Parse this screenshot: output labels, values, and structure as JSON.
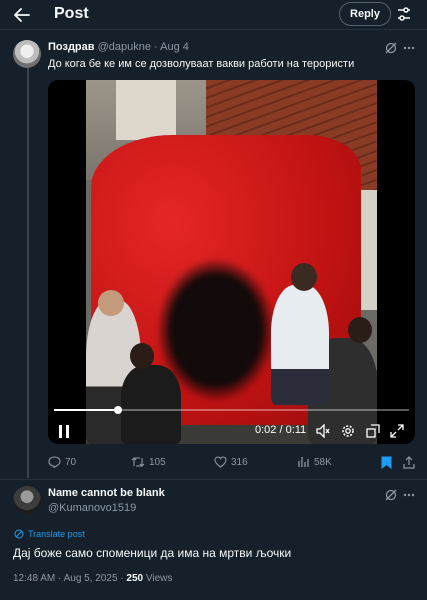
{
  "header": {
    "title": "Post",
    "reply_label": "Reply"
  },
  "post1": {
    "author_name": "Поздрав",
    "handle": "@dapukne",
    "separator": "·",
    "date": "Aug 4",
    "text": "До кога бе ке им се дозволуваат вакви работи на терористи",
    "video": {
      "time_display": "0:02 / 0:11",
      "progress": 0.18
    },
    "stats": {
      "replies": "70",
      "reposts": "105",
      "likes": "316",
      "views": "58K"
    }
  },
  "post2": {
    "author_name": "Name cannot be blank",
    "handle": "@Kumanovo1519",
    "translate_label": "Translate post",
    "text": "Дај боже само споменици да има на мртви љочки",
    "time": "12:48 AM · Aug 5, 2025 · ",
    "views_count": "250",
    "views_label": " Views"
  },
  "colors": {
    "background": "#15202b",
    "accent": "#1d9bf0",
    "muted": "#8b98a5",
    "text": "#f7f9f9"
  },
  "icons": {
    "back": "arrow-left-icon",
    "tune": "sliders-icon",
    "grok": "grok-icon",
    "more": "more-icon",
    "pause": "pause-icon",
    "volume": "volume-muted-icon",
    "settings": "gear-icon",
    "pip": "picture-in-picture-icon",
    "fullscreen": "fullscreen-icon",
    "reply": "reply-icon",
    "repost": "repost-icon",
    "like": "heart-icon",
    "views": "views-icon",
    "bookmark": "bookmark-icon",
    "share": "share-icon",
    "translate": "translate-icon"
  }
}
